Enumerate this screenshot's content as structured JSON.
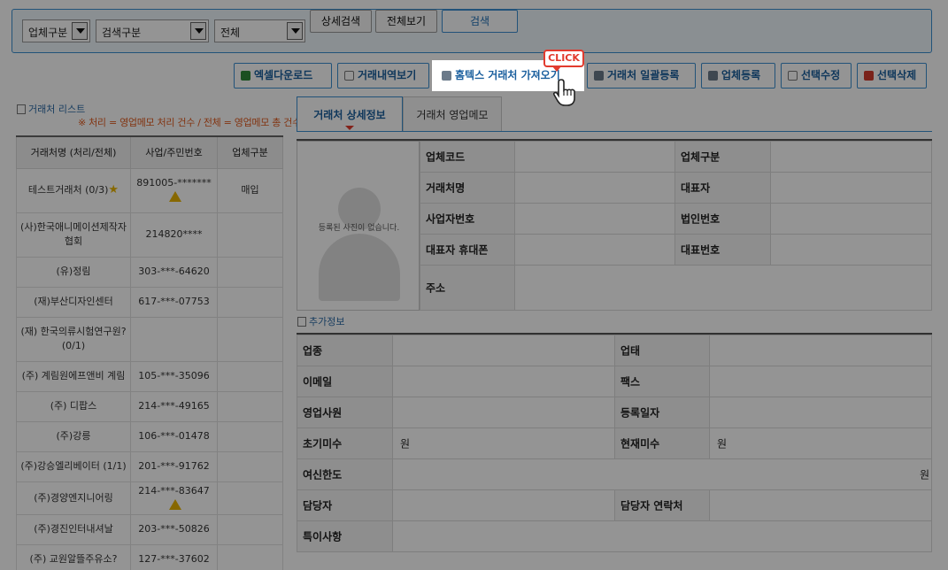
{
  "search": {
    "select1": "업체구분",
    "select2": "검색구분",
    "select3": "전체",
    "btn_detail": "상세검색",
    "btn_all": "전체보기",
    "btn_search": "검색"
  },
  "toolbar": {
    "excel": "엑셀다운로드",
    "history": "거래내역보기",
    "hometax": "홈텍스 거래처 가져오기",
    "bulk": "거래처 일괄등록",
    "register": "업체등록",
    "edit": "선택수정",
    "delete": "선택삭제",
    "click_badge": "CLICK"
  },
  "list": {
    "title": "거래처 리스트",
    "note": "※ 처리 = 영업메모 처리 건수 / 전체 = 영업메모 총 건수",
    "headers": [
      "거래처명 (처리/전체)",
      "사업/주민번호",
      "업체구분"
    ],
    "rows": [
      {
        "name": "테스트거래처 (0/3)",
        "num": "891005-*******",
        "type": "매입"
      },
      {
        "name": "(사)한국애니메이션제작자협회",
        "num": "214820****",
        "type": ""
      },
      {
        "name": "(유)정림",
        "num": "303-***-64620",
        "type": ""
      },
      {
        "name": "(재)부산디자인센터",
        "num": "617-***-07753",
        "type": ""
      },
      {
        "name": "(재) 한국의류시험연구원? (0/1)",
        "num": "",
        "type": ""
      },
      {
        "name": "(주) 계림원에프앤비 계림",
        "num": "105-***-35096",
        "type": ""
      },
      {
        "name": "(주) 디팝스",
        "num": "214-***-49165",
        "type": ""
      },
      {
        "name": "(주)강릉",
        "num": "106-***-01478",
        "type": ""
      },
      {
        "name": "(주)강승엘리베이터 (1/1)",
        "num": "201-***-91762",
        "type": ""
      },
      {
        "name": "(주)경양엔지니어링",
        "num": "214-***-83647",
        "type": ""
      },
      {
        "name": "(주)경진인터내셔날",
        "num": "203-***-50826",
        "type": ""
      },
      {
        "name": "(주) 교원알뜰주유소?",
        "num": "127-***-37602",
        "type": ""
      }
    ]
  },
  "tabs": {
    "detail": "거래처 상세정보",
    "memo": "거래처 영업메모"
  },
  "detail": {
    "photo_msg": "등록된 사진이 없습니다.",
    "code": "업체코드",
    "category": "업체구분",
    "name": "거래처명",
    "ceo": "대표자",
    "bizno": "사업자번호",
    "corpno": "법인번호",
    "ceo_phone": "대표자 휴대폰",
    "main_phone": "대표번호",
    "address": "주소"
  },
  "extra": {
    "title": "추가정보",
    "industry": "업종",
    "biztype": "업태",
    "email": "이메일",
    "fax": "팩스",
    "sales_rep": "영업사원",
    "reg_date": "등록일자",
    "init_unpaid": "초기미수",
    "init_unpaid_unit": "원",
    "cur_unpaid": "현재미수",
    "cur_unpaid_unit": "원",
    "credit": "여신한도",
    "credit_unit": "원",
    "manager": "담당자",
    "manager_contact": "담당자 연락처",
    "notes": "특이사항"
  }
}
